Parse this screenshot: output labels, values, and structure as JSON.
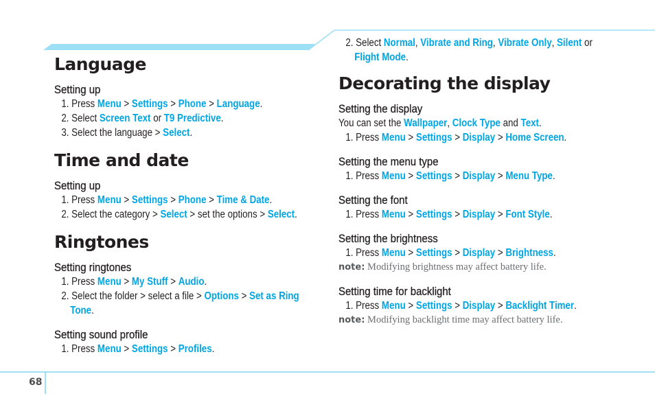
{
  "page_number": "68",
  "colors": {
    "accent": "#00a6e4",
    "rule": "#9ddff5",
    "text": "#231f20",
    "note": "#6d6e71"
  },
  "left": {
    "language": {
      "title": "Language",
      "sub": "Setting up",
      "steps": [
        {
          "n": "1. Press ",
          "a": "Menu",
          "s1": " > ",
          "b": "Settings",
          "s2": " > ",
          "c": "Phone",
          "s3": " > ",
          "d": "Language",
          "end": "."
        },
        {
          "n": "2. Select ",
          "a": "Screen Text",
          "s1": " or ",
          "b": "T9 Predictive",
          "end": "."
        },
        {
          "n": "3. Select the language > ",
          "a": "Select",
          "end": "."
        }
      ]
    },
    "time": {
      "title": "Time and date",
      "sub": "Setting up",
      "steps": [
        {
          "n": "1. Press ",
          "a": "Menu",
          "s1": " > ",
          "b": "Settings",
          "s2": " > ",
          "c": "Phone",
          "s3": " > ",
          "d": "Time & Date",
          "end": "."
        },
        {
          "n": "2. Select the category > ",
          "a": "Select",
          "s1": " > set the options > ",
          "b": "Select",
          "end": "."
        }
      ]
    },
    "ringtones": {
      "title": "Ringtones",
      "sub1": "Setting ringtones",
      "steps1": [
        {
          "n": "1. Press ",
          "a": "Menu",
          "s1": " > ",
          "b": "My Stuff",
          "s2": " > ",
          "c": "Audio",
          "end": "."
        },
        {
          "n": "2. Select the folder > select a file > ",
          "a": "Options",
          "s1": " > ",
          "b": "Set as Ring",
          "cont": "Tone",
          "end": "."
        }
      ],
      "sub2": "Setting sound profile",
      "steps2": [
        {
          "n": "1. Press ",
          "a": "Menu",
          "s1": " > ",
          "b": "Settings",
          "s2": " > ",
          "c": "Profiles",
          "end": "."
        }
      ]
    }
  },
  "right": {
    "carry": {
      "n": "2. Select ",
      "a": "Normal",
      "s1": ", ",
      "b": "Vibrate and Ring",
      "s2": ", ",
      "c": "Vibrate Only",
      "s3": ", ",
      "d": "Silent",
      "s4": " or",
      "e": "Flight Mode",
      "end": "."
    },
    "title": "Decorating the display",
    "display": {
      "sub": "Setting the display",
      "intro": {
        "t1": "You can set the ",
        "a": "Wallpaper",
        "s1": ", ",
        "b": "Clock Type",
        "s2": " and ",
        "c": "Text",
        "end": "."
      },
      "step": {
        "n": "1. Press ",
        "a": "Menu",
        "s1": " > ",
        "b": "Settings",
        "s2": " > ",
        "c": "Display",
        "s3": " > ",
        "d": "Home Screen",
        "end": "."
      }
    },
    "menu": {
      "sub": "Setting the menu type",
      "step": {
        "n": "1. Press ",
        "a": "Menu",
        "s1": " > ",
        "b": "Settings",
        "s2": " > ",
        "c": "Display",
        "s3": " > ",
        "d": "Menu Type",
        "end": "."
      }
    },
    "font": {
      "sub": "Setting the font",
      "step": {
        "n": "1. Press ",
        "a": "Menu",
        "s1": " > ",
        "b": "Settings",
        "s2": " > ",
        "c": "Display",
        "s3": " > ",
        "d": "Font Style",
        "end": "."
      }
    },
    "brightness": {
      "sub": "Setting the brightness",
      "step": {
        "n": "1. Press ",
        "a": "Menu",
        "s1": " > ",
        "b": "Settings",
        "s2": " > ",
        "c": "Display",
        "s3": " > ",
        "d": "Brightness",
        "end": "."
      },
      "note_label": "note:",
      "note": " Modifying brightness may affect battery life."
    },
    "backlight": {
      "sub": "Setting time for backlight",
      "step": {
        "n": "1. Press ",
        "a": "Menu",
        "s1": " > ",
        "b": "Settings",
        "s2": " > ",
        "c": "Display",
        "s3": " > ",
        "d": "Backlight Timer",
        "end": "."
      },
      "note_label": "note:",
      "note": " Modifying backlight time may affect battery life."
    }
  }
}
